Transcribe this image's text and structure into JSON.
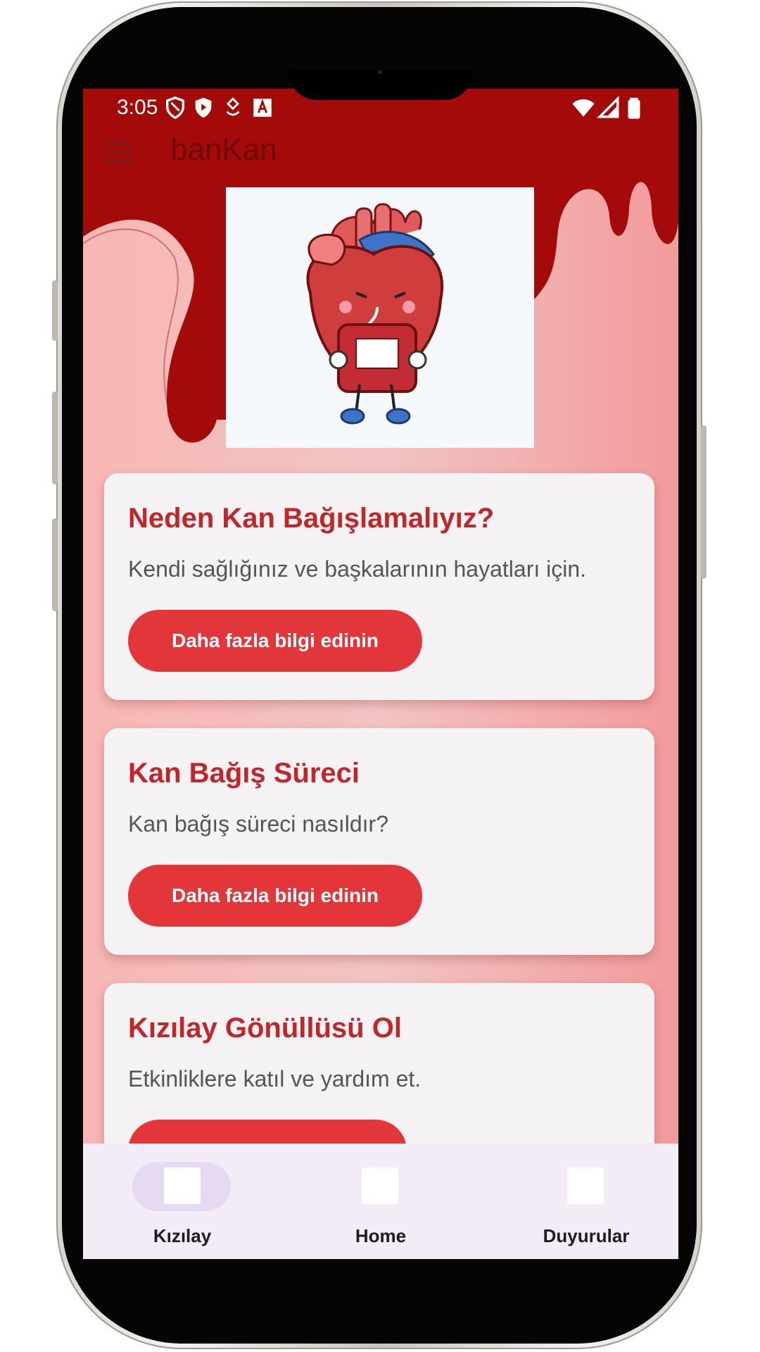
{
  "status_bar": {
    "time": "3:05"
  },
  "app_bar": {
    "title": "banKan"
  },
  "cards": [
    {
      "title": "Neden Kan Bağışlamalıyız?",
      "text": "Kendi sağlığınız ve başkalarının hayatları için.",
      "button_label": "Daha fazla bilgi edinin"
    },
    {
      "title": "Kan Bağış Süreci",
      "text": "Kan bağış süreci nasıldır?",
      "button_label": "Daha fazla bilgi edinin"
    },
    {
      "title": "Kızılay Gönüllüsü Ol",
      "text": "Etkinliklere katıl ve yardım et.",
      "button_label": ""
    }
  ],
  "bottom_nav": {
    "items": [
      {
        "label": "Kızılay",
        "active": true
      },
      {
        "label": "Home",
        "active": false
      },
      {
        "label": "Duyurular",
        "active": false
      }
    ]
  },
  "colors": {
    "primary": "#a50a0a",
    "accent": "#e3363a",
    "title_red": "#c0262a",
    "background_pink": "#f6a9a9",
    "nav_bg": "#f3ecf6"
  }
}
